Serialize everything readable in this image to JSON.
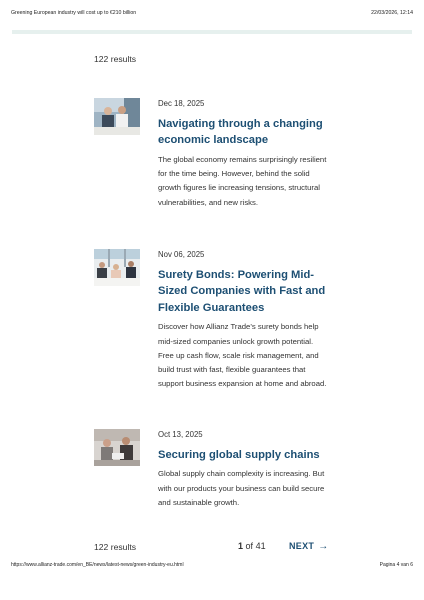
{
  "print_header": {
    "title": "Greening European industry will cost up to €210 billion",
    "date": "22/03/2026, 12:14"
  },
  "results_count": "122 results",
  "articles": [
    {
      "date": "Dec 18, 2025",
      "title": "Navigating through a changing economic landscape",
      "description": "The global economy remains surprisingly resilient for the time being. However, behind the solid growth figures lie increasing ten­sions, structural vulnerabilities, and new risks."
    },
    {
      "date": "Nov 06, 2025",
      "title": "Surety Bonds: Powering Mid-Sized Companies with Fast and Flexible Guarantees",
      "description": "Discover how Allianz Trade’s surety bonds help mid-sized companies unlock growth potential. Free up cash flow, scale risk man­agement, and build trust with fast, flexible guarantees that support business expan­sion at home and abroad."
    },
    {
      "date": "Oct 13, 2025",
      "title": "Securing global supply chains",
      "description": "Global supply chain complexity is increas­ing. But with our products your business can build secure and sustainable growth."
    }
  ],
  "pagination": {
    "results": "122 results",
    "current_page": "1",
    "of_label": "of",
    "total_pages": "41",
    "next_label": "NEXT",
    "next_arrow": "→"
  },
  "print_footer": {
    "url": "https://www.allianz-trade.com/en_BE/news/latest-news/green-industry-eu.html",
    "page": "Pagina 4 van 6"
  },
  "colors": {
    "link": "#1d4f73",
    "text": "#333333",
    "band": "#e6f0ee"
  },
  "icons": {
    "next": "arrow-right-icon"
  }
}
